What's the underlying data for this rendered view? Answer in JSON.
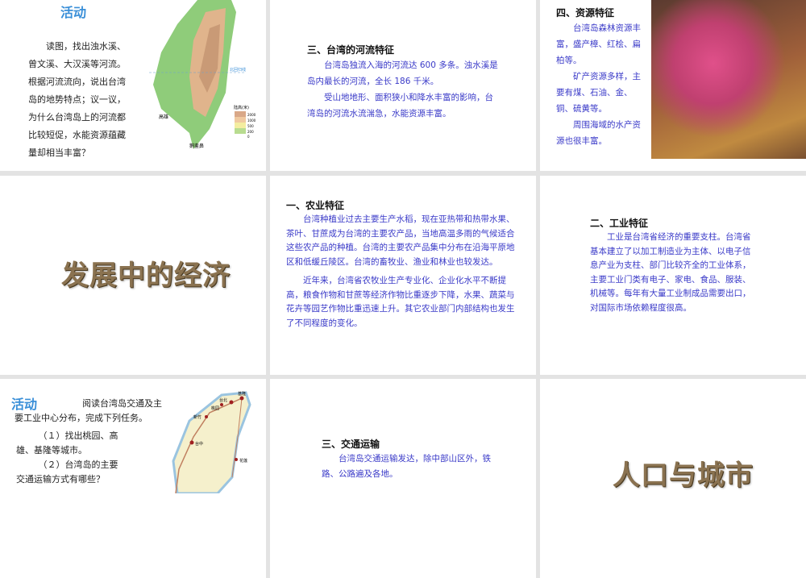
{
  "slides": [
    {
      "activity_title": "活动",
      "text": [
        "读图，找出浊水溪、",
        "曾文溪、大汉溪等河流。",
        "根据河流流向，说出台湾",
        "岛的地势特点；议一议，",
        "为什么台湾岛上的河流都",
        "比较短促，水能资源蕴藏",
        "量却相当丰富？"
      ],
      "map_labels": {
        "legend_title": "陆高(米)",
        "legend": [
          "2000",
          "1000",
          "500",
          "200",
          "0"
        ],
        "city1": "高雄",
        "city2": "鹅銮鼻",
        "tropic": "北回归线"
      }
    },
    {
      "heading": "三、台湾的河流特征",
      "paragraphs": [
        "台湾岛独流入海的河流达 600 多条。浊水溪是岛内最长的河流，全长 186 千米。",
        "受山地地形、面积狭小和降水丰富的影响，台湾岛的河流水流湍急，水能资源丰富。"
      ]
    },
    {
      "heading": "四、资源特征",
      "paragraphs": [
        "台湾岛森林资源丰富，盛产樟、红桧、扁柏等。",
        "矿产资源多样，主要有煤、石油、金、铜、硫黄等。",
        "周围海域的水产资源也很丰富。"
      ]
    },
    {
      "title": "发展中的经济"
    },
    {
      "heading": "一、农业特征",
      "paragraphs": [
        "台湾种植业过去主要生产水稻，现在亚热带和热带水果、茶叶、甘蔗成为台湾的主要农产品，当地高温多雨的气候适合这些农产品的种植。台湾的主要农产品集中分布在沿海平原地区和低缓丘陵区。台湾的畜牧业、渔业和林业也较发达。",
        "近年来，台湾省农牧业生产专业化、企业化水平不断提高，粮食作物和甘蔗等经济作物比重逐步下降，水果、蔬菜与花卉等园艺作物比重迅速上升。其它农业部门内部结构也发生了不同程度的变化。"
      ]
    },
    {
      "heading": "二、工业特征",
      "paragraphs": [
        "工业是台湾省经济的重要支柱。台湾省基本建立了以加工制造业为主体、以电子信息产业为支柱、部门比较齐全的工业体系，主要工业门类有电子、家电、食品、服装、机械等。每年有大量工业制成品需要出口，对国际市场依赖程度很高。"
      ]
    },
    {
      "activity_title": "活动",
      "intro": "阅读台湾岛交通及主",
      "intro2": "要工业中心分布，完成下列任务。",
      "tasks": [
        "（１）找出桃园、高",
        "雄、基隆等城市。",
        "（２）台湾岛的主要",
        "交通运输方式有哪些？"
      ],
      "map_labels": [
        "基隆",
        "台北",
        "桃园",
        "新竹",
        "台中",
        "花莲"
      ]
    },
    {
      "heading": "三、交通运输",
      "paragraphs": [
        "台湾岛交通运输发达，除中部山区外，铁路、公路遍及各地。"
      ]
    },
    {
      "title": "人口与城市"
    }
  ]
}
